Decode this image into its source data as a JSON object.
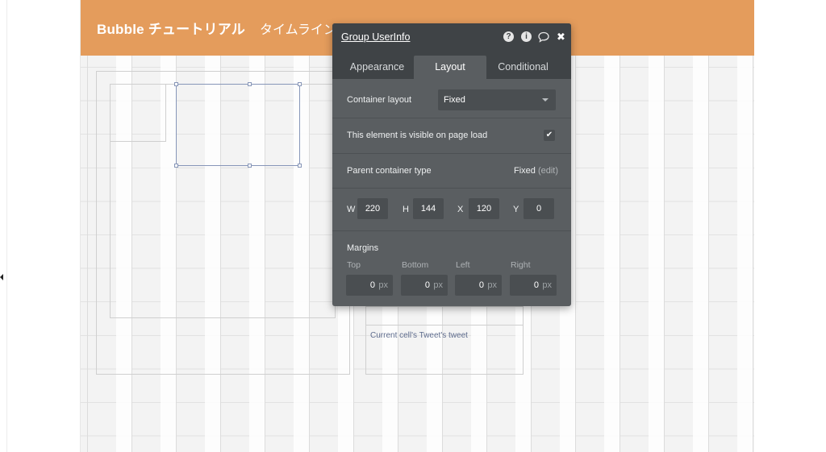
{
  "header": {
    "brand": "Bubble チュートリアル",
    "nav_timeline": "タイムライン"
  },
  "canvas": {
    "repeating_group_text": "Current cell's Tweet's tweet"
  },
  "panel": {
    "title": "Group UserInfo",
    "icons": [
      "help-icon",
      "info-icon",
      "comment-icon",
      "close-icon"
    ],
    "icon_glyphs": {
      "help": "?",
      "info": "i",
      "close": "✖"
    },
    "tabs": [
      {
        "label": "Appearance",
        "active": false
      },
      {
        "label": "Layout",
        "active": true
      },
      {
        "label": "Conditional",
        "active": false
      }
    ],
    "container_layout_label": "Container layout",
    "container_layout_value": "Fixed",
    "visible_label": "This element is visible on page load",
    "visible_checked": true,
    "visible_check_glyph": "✔",
    "parent_type_label": "Parent container type",
    "parent_type_value": "Fixed",
    "parent_type_edit": "(edit)",
    "dimensions": {
      "w_label": "W",
      "w_value": "220",
      "h_label": "H",
      "h_value": "144",
      "x_label": "X",
      "x_value": "120",
      "y_label": "Y",
      "y_value": "0"
    },
    "margins": {
      "title": "Margins",
      "top_label": "Top",
      "top_value": "0",
      "bottom_label": "Bottom",
      "bottom_value": "0",
      "left_label": "Left",
      "left_value": "0",
      "right_label": "Right",
      "right_value": "0",
      "unit": "px"
    }
  },
  "colors": {
    "header_bg": "#e49c5c",
    "panel_bg": "#5a5e61",
    "panel_dark": "#3f4346",
    "selection": "#8796b8"
  }
}
